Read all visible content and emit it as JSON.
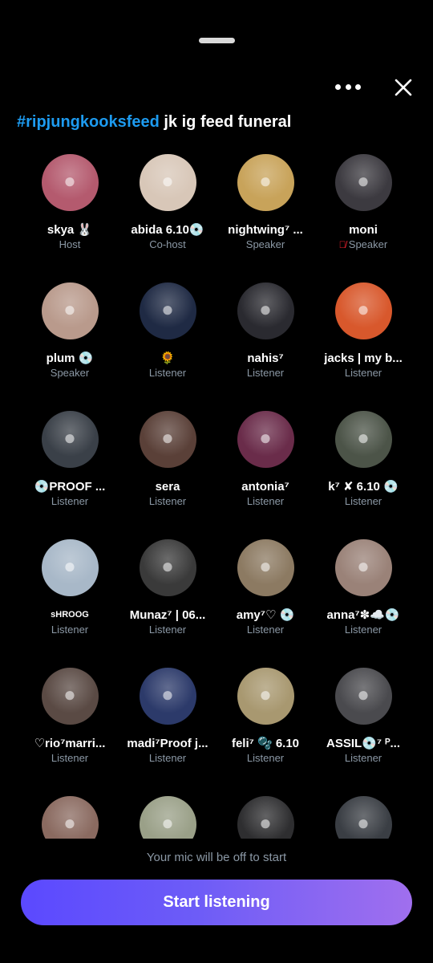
{
  "space": {
    "hashtag": "#ripjungkooksfeed",
    "title_rest": "jk ig feed funeral"
  },
  "participants": [
    {
      "name": "skya 🐰",
      "role": "Host",
      "color": "#b45a6e"
    },
    {
      "name": "abida 6.10💿",
      "role": "Co-host",
      "color": "#d8c7b8"
    },
    {
      "name": "nightwing⁷ ...",
      "role": "Speaker",
      "color": "#c8a35a"
    },
    {
      "name": "moni",
      "role": "Speaker",
      "muted": true,
      "color": "#3c3a40"
    },
    {
      "name": "plum 💿",
      "role": "Speaker",
      "color": "#b99a8c"
    },
    {
      "name": "🌻",
      "role": "Listener",
      "color": "#1f2a44"
    },
    {
      "name": "nahis⁷",
      "role": "Listener",
      "color": "#2a2a30"
    },
    {
      "name": "jacks | my b...",
      "role": "Listener",
      "color": "#d8582c"
    },
    {
      "name": "💿PROOF ...",
      "role": "Listener",
      "color": "#3a4048"
    },
    {
      "name": "sera",
      "role": "Listener",
      "color": "#5a4038"
    },
    {
      "name": "antonia⁷",
      "role": "Listener",
      "color": "#6a2c4a"
    },
    {
      "name": "k⁷ ✘ 6.10 💿",
      "role": "Listener",
      "color": "#4c5448"
    },
    {
      "name": "sHROOG",
      "role": "Listener",
      "small": true,
      "color": "#a8b8c8"
    },
    {
      "name": "Munaz⁷ | 06...",
      "role": "Listener",
      "color": "#3a3a3a"
    },
    {
      "name": "amy⁷♡ 💿",
      "role": "Listener",
      "color": "#8c7a62"
    },
    {
      "name": "anna⁷✽☁️💿",
      "role": "Listener",
      "color": "#9a8278"
    },
    {
      "name": "♡rio⁷marri...",
      "role": "Listener",
      "color": "#5a4a44"
    },
    {
      "name": "madi⁷Proof j...",
      "role": "Listener",
      "color": "#2c3a6a"
    },
    {
      "name": "feli⁷ 🫧 6.10",
      "role": "Listener",
      "color": "#a89870"
    },
    {
      "name": "ASSIL💿⁷ ᴾ...",
      "role": "Listener",
      "color": "#4a4a4e"
    },
    {
      "name": "",
      "role": "",
      "color": "#8a6a60"
    },
    {
      "name": "",
      "role": "",
      "color": "#9aa088"
    },
    {
      "name": "",
      "role": "",
      "color": "#2e2e30"
    },
    {
      "name": "",
      "role": "",
      "color": "#3a3e44"
    }
  ],
  "footer": {
    "mic_note": "Your mic will be off to start",
    "start_label": "Start listening"
  },
  "icons": {
    "more": "more-icon",
    "close": "close-icon",
    "mic_off": "mic-off-icon"
  }
}
